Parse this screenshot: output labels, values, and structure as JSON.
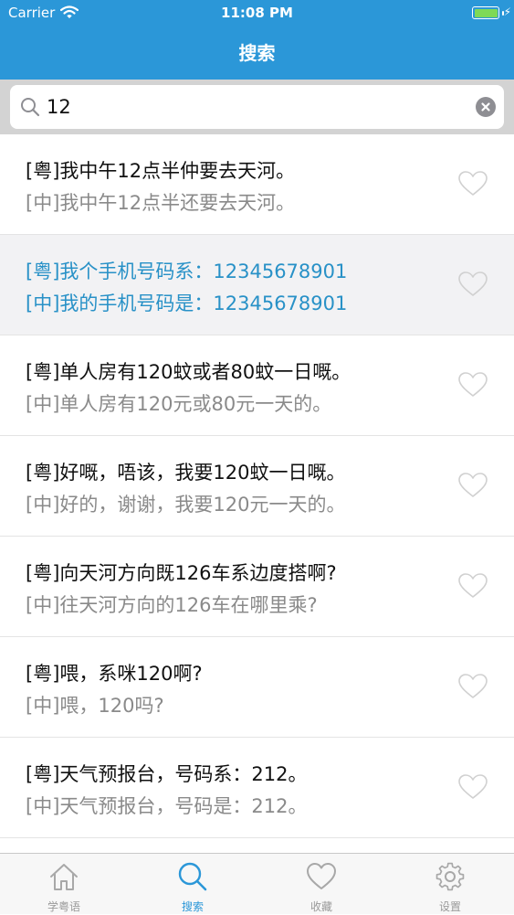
{
  "status_bar": {
    "carrier": "Carrier",
    "time": "11:08 PM",
    "battery_level": 1.0
  },
  "header": {
    "title": "搜索"
  },
  "search": {
    "value": "12",
    "placeholder": ""
  },
  "results": [
    {
      "cantonese": "[粤]我中午12点半仲要去天河。",
      "mandarin": "[中]我中午12点半还要去天河。",
      "highlighted": false
    },
    {
      "cantonese": "[粤]我个手机号码系：12345678901",
      "mandarin": "[中]我的手机号码是：12345678901",
      "highlighted": true
    },
    {
      "cantonese": "[粤]单人房有120蚊或者80蚊一日嘅。",
      "mandarin": "[中]单人房有120元或80元一天的。",
      "highlighted": false
    },
    {
      "cantonese": "[粤]好嘅，唔该，我要120蚊一日嘅。",
      "mandarin": "[中]好的，谢谢，我要120元一天的。",
      "highlighted": false
    },
    {
      "cantonese": "[粤]向天河方向既126车系边度搭啊?",
      "mandarin": "[中]往天河方向的126车在哪里乘?",
      "highlighted": false
    },
    {
      "cantonese": "[粤]喂，系咪120啊?",
      "mandarin": "[中]喂，120吗?",
      "highlighted": false
    },
    {
      "cantonese": "[粤]天气预报台，号码系：212。",
      "mandarin": "[中]天气预报台，号码是：212。",
      "highlighted": false
    }
  ],
  "tabs": [
    {
      "label": "学粤语",
      "icon": "home-icon",
      "active": false
    },
    {
      "label": "搜索",
      "icon": "search-icon",
      "active": true
    },
    {
      "label": "收藏",
      "icon": "heart-icon",
      "active": false
    },
    {
      "label": "设置",
      "icon": "gear-icon",
      "active": false
    }
  ],
  "colors": {
    "accent": "#2b97d8",
    "highlight_text": "#2891c7",
    "search_bar_bg": "#d3d3d3",
    "secondary_text": "#8a8a8a"
  }
}
